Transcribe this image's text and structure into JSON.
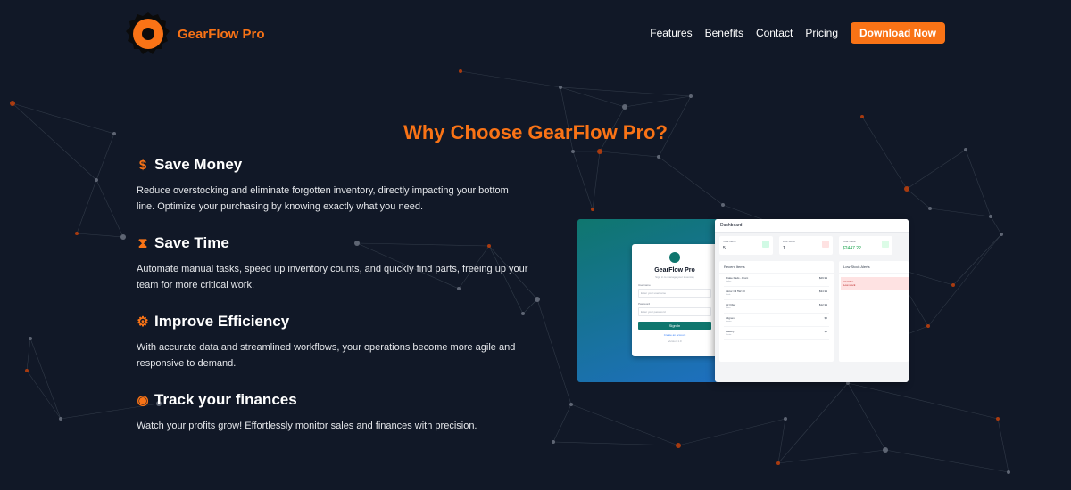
{
  "brand": {
    "name": "GearFlow Pro"
  },
  "nav": {
    "links": [
      "Features",
      "Benefits",
      "Contact",
      "Pricing"
    ],
    "cta": "Download Now"
  },
  "section": {
    "title": "Why Choose GearFlow Pro?"
  },
  "features": [
    {
      "icon": "dollar-icon",
      "glyph": "$",
      "title": "Save Money",
      "text": "Reduce overstocking and eliminate forgotten inventory, directly impacting your bottom line. Optimize your purchasing by knowing exactly what you need."
    },
    {
      "icon": "hourglass-icon",
      "glyph": "⧗",
      "title": "Save Time",
      "text": "Automate manual tasks, speed up inventory counts, and quickly find parts, freeing up your team for more critical work."
    },
    {
      "icon": "gears-icon",
      "glyph": "⚙",
      "title": "Improve Efficiency",
      "text": "With accurate data and streamlined workflows, your operations become more agile and responsive to demand."
    },
    {
      "icon": "coins-icon",
      "glyph": "◉",
      "title": "Track your finances",
      "text": "Watch your profits grow! Effortlessly monitor sales and finances with precision."
    }
  ],
  "mockup": {
    "login": {
      "title": "GearFlow Pro",
      "subtitle": "Sign in to manage your inventory",
      "username_label": "Username",
      "username_placeholder": "Enter your username",
      "password_label": "Password",
      "password_placeholder": "Enter your password",
      "button": "Sign In",
      "link": "Create an account",
      "footer": "Version 1.0"
    },
    "dashboard": {
      "title": "Dashboard",
      "cards": [
        {
          "label": "Total Items",
          "value": "5",
          "color": "#d1fae5"
        },
        {
          "label": "Low Stock",
          "value": "1",
          "color": "#fee2e2"
        },
        {
          "label": "Total Value",
          "value": "$2447.22",
          "color": "#dcfce7"
        }
      ],
      "recent_title": "Recent Items",
      "recent": [
        {
          "name": "Brake Pads - Front",
          "sub": "Brakes",
          "value": "$29.99"
        },
        {
          "name": "Motor Oil 5W-30",
          "sub": "Fluids",
          "value": "$34.99"
        },
        {
          "name": "Air Filter",
          "sub": "Filters",
          "value": "$12.99"
        },
        {
          "name": "Alignex",
          "sub": "Service",
          "value": "$0"
        },
        {
          "name": "Battery",
          "sub": "Electric",
          "value": "$0"
        }
      ],
      "lowstock_title": "Low Stock Alerts",
      "lowstock": [
        {
          "name": "Air Filter",
          "sub": "Low stock"
        }
      ]
    }
  }
}
